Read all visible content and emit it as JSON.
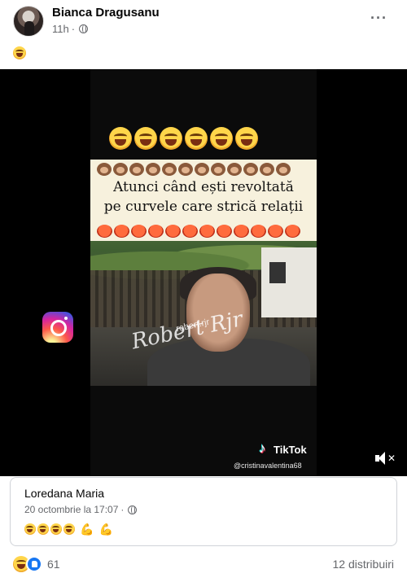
{
  "post": {
    "author": "Bianca Dragusanu",
    "time": "11h",
    "audience_icon": "globe-icon",
    "caption_emoji": "rolling-on-floor-laughing-emoji"
  },
  "video": {
    "banner_text_line1": "Atunci când ești revoltată",
    "banner_text_line2": "pe curvele care strică relații",
    "watermark": "Robert Rjr",
    "watermark_sub": "robert.rjr",
    "tiktok_label": "TikTok",
    "tiktok_user": "@cristinavalentina68",
    "mute_icon": "speaker-muted-icon"
  },
  "comment": {
    "author": "Loredana Maria",
    "timestamp": "20 octombrie la 17:07"
  },
  "footer": {
    "reaction_count": "61",
    "shares": "12 distribuiri"
  },
  "colors": {
    "accent": "#1877f2",
    "secondary_text": "#65676b",
    "video_bg": "#000000"
  }
}
